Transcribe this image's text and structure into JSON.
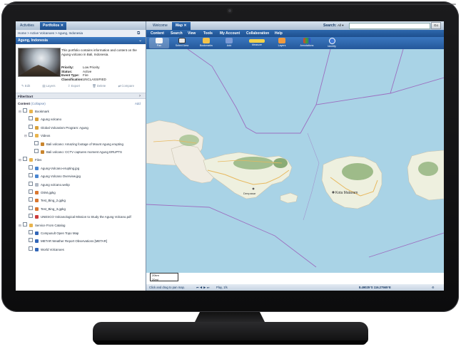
{
  "left_tabs": [
    "Activities",
    "Portfolios"
  ],
  "breadcrumb": "Home > Active Volcanoes > Agung, Indonesia",
  "portfolio": {
    "title": "Agung, Indonesia",
    "description": "This portfolio contains information and content on the Agung volcano in Bali, Indonesia.",
    "meta": [
      {
        "label": "Priority:",
        "value": "Low Priority"
      },
      {
        "label": "Status:",
        "value": "Active"
      },
      {
        "label": "Event Type:",
        "value": "Fire"
      },
      {
        "label": "Classification:",
        "value": "UNCLASSIFIED"
      }
    ],
    "actions": [
      "Edit",
      "Layers",
      "Export",
      "Delete",
      "Compare"
    ]
  },
  "filter_label": "Filter/Sort",
  "content_label": "Content",
  "collapse_label": "(Collapse)",
  "add_label": "Add",
  "tree": [
    {
      "label": "Bookmark",
      "level": 1,
      "icon": "folder"
    },
    {
      "label": "Agung volcano",
      "level": 2,
      "icon": "bookmark"
    },
    {
      "label": "Global Volcanism Program: Agung",
      "level": 2,
      "icon": "bookmark"
    },
    {
      "label": "Videos",
      "level": 2,
      "icon": "folder"
    },
    {
      "label": "Bali volcano: Amazing footage of Mount Agung erupting",
      "level": 3,
      "icon": "video"
    },
    {
      "label": "Bali volcano: CCTV captures moment Agung ERUPTS",
      "level": 3,
      "icon": "video"
    },
    {
      "label": "Files",
      "level": 1,
      "icon": "folder"
    },
    {
      "label": "Agung-Volcano-erupting.jpg",
      "level": 2,
      "icon": "image"
    },
    {
      "label": "Agung Volcano Overview.jpg",
      "level": 2,
      "icon": "image"
    },
    {
      "label": "Agung volcano.webp",
      "level": 2,
      "icon": "file"
    },
    {
      "label": "OSM.gpkg",
      "level": 2,
      "icon": "layer"
    },
    {
      "label": "Test_Bing_2.gpkg",
      "level": 2,
      "icon": "layer"
    },
    {
      "label": "Test_Bing_3.gpkg",
      "level": 2,
      "icon": "layer"
    },
    {
      "label": "UNESCO Volcanological Mission to Study the Agung Volcano.pdf",
      "level": 2,
      "icon": "pdf"
    },
    {
      "label": "Service From Catalog",
      "level": 1,
      "icon": "folder"
    },
    {
      "label": "Compusult Open Topo Map",
      "level": 2,
      "icon": "service"
    },
    {
      "label": "METAR Weather Report Observations [METAR]",
      "level": 2,
      "icon": "service"
    },
    {
      "label": "World Volcanoes",
      "level": 2,
      "icon": "service"
    }
  ],
  "map_tabs": [
    "Welcome",
    "Map"
  ],
  "search": {
    "label": "Search:",
    "scope": "All",
    "placeholder": "",
    "go": "Go"
  },
  "menu": [
    "Content",
    "Search",
    "View",
    "Tools",
    "My Account",
    "Collaboration",
    "Help"
  ],
  "tools": [
    "Pan",
    "Select Area",
    "Bookmarks",
    "Add",
    "Measure",
    "Layers",
    "Annotations",
    "Identify"
  ],
  "map_labels": {
    "city": "Kota Mataram",
    "city2": "Denpasar"
  },
  "scale": {
    "top": "20km",
    "bottom": "20mi"
  },
  "status": {
    "hint": "Click and drag to pan map.",
    "play": "Play, 1fs",
    "coords": "8.49025°S 116.27565°E"
  },
  "colors": {
    "accent": "#25599b",
    "water": "#a9d3e6",
    "land": "#f0ece2"
  }
}
